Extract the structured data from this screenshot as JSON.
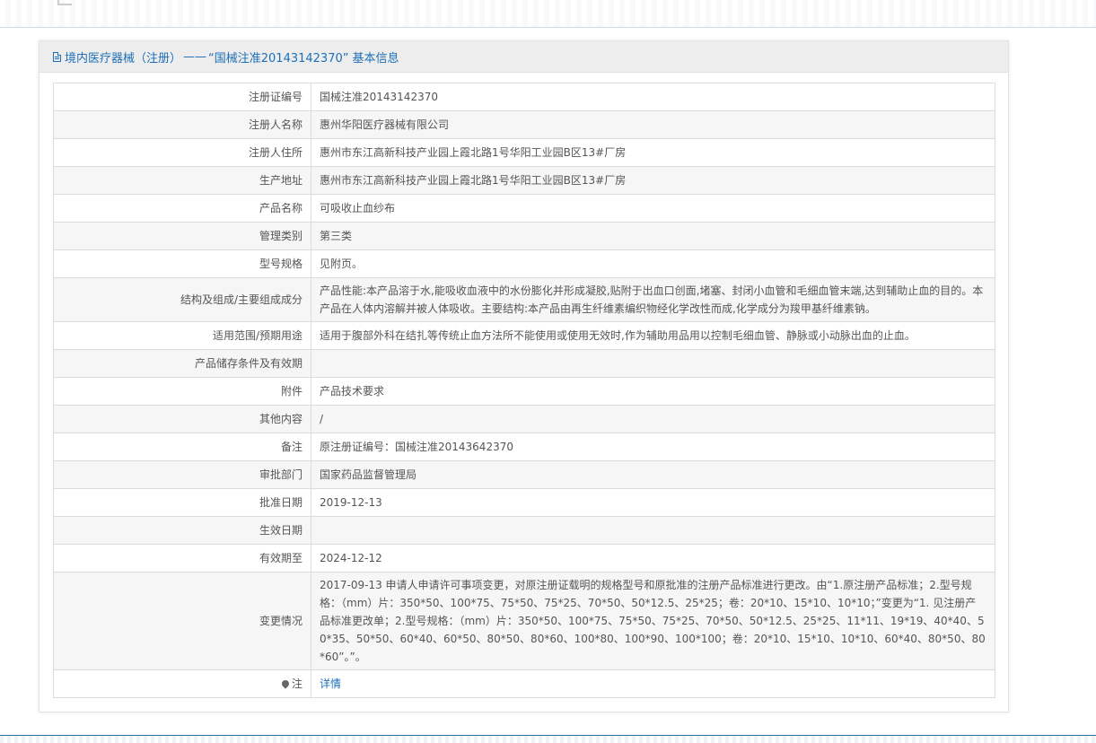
{
  "title": {
    "prefix": "境内医疗器械（注册）",
    "dash": "——",
    "reg_no_quoted": "“国械注准20143142370”",
    "suffix": "基本信息"
  },
  "rows": [
    {
      "label": "注册证编号",
      "value": "国械注准20143142370"
    },
    {
      "label": "注册人名称",
      "value": "惠州华阳医疗器械有限公司"
    },
    {
      "label": "注册人住所",
      "value": "惠州市东江高新科技产业园上霞北路1号华阳工业园B区13#厂房"
    },
    {
      "label": "生产地址",
      "value": "惠州市东江高新科技产业园上霞北路1号华阳工业园B区13#厂房"
    },
    {
      "label": "产品名称",
      "value": "可吸收止血纱布"
    },
    {
      "label": "管理类别",
      "value": "第三类"
    },
    {
      "label": "型号规格",
      "value": "见附页。"
    },
    {
      "label": "结构及组成/主要组成成分",
      "value": "产品性能:本产品溶于水,能吸收血液中的水份膨化并形成凝胶,贴附于出血口创面,堵塞、封闭小血管和毛细血管末端,达到辅助止血的目的。本产品在人体内溶解并被人体吸收。主要结构:本产品由再生纤维素编织物经化学改性而成,化学成分为羧甲基纤维素钠。"
    },
    {
      "label": "适用范围/预期用途",
      "value": "适用于腹部外科在结扎等传统止血方法所不能使用或使用无效时,作为辅助用品用以控制毛细血管、静脉或小动脉出血的止血。"
    },
    {
      "label": "产品储存条件及有效期",
      "value": ""
    },
    {
      "label": "附件",
      "value": "产品技术要求"
    },
    {
      "label": "其他内容",
      "value": "/"
    },
    {
      "label": "备注",
      "value": "原注册证编号：国械注准20143642370"
    },
    {
      "label": "审批部门",
      "value": "国家药品监督管理局"
    },
    {
      "label": "批准日期",
      "value": "2019-12-13"
    },
    {
      "label": "生效日期",
      "value": ""
    },
    {
      "label": "有效期至",
      "value": "2024-12-12"
    },
    {
      "label": "变更情况",
      "value": "2017-09-13 申请人申请许可事项变更，对原注册证载明的规格型号和原批准的注册产品标准进行更改。由“1.原注册产品标准；2.型号规格：（mm）片：350*50、100*75、75*50、75*25、70*50、50*12.5、25*25；卷：20*10、15*10、10*10；”变更为“1. 见注册产品标准更改单；2.型号规格：（mm）片：350*50、100*75、75*50、75*25、70*50、50*12.5、25*25、11*11、19*19、40*40、50*35、50*50、60*40、60*50、80*50、80*60、100*80、100*90、100*100；卷：20*10、15*10、10*10、60*40、80*50、80*60”。”。"
    }
  ],
  "note": {
    "label": "注",
    "link": "详情"
  },
  "icons": {
    "title_icon": "document-icon",
    "note_icon": "map-pin-icon"
  },
  "colors": {
    "link": "#1e6fb7",
    "header_bg": "#ededed",
    "stripe": "#f6f6f6"
  }
}
